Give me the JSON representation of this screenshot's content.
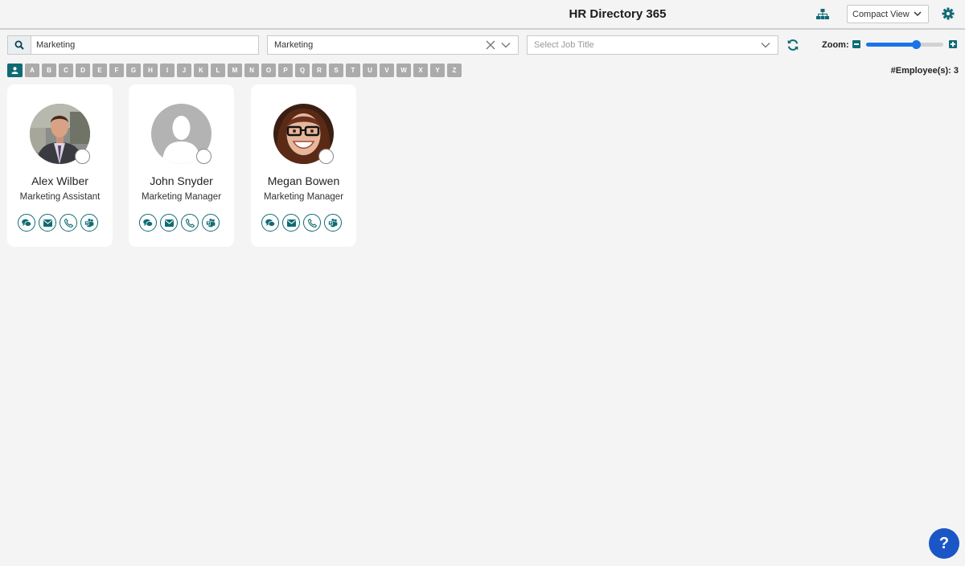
{
  "header": {
    "title": "HR Directory 365",
    "view_mode": "Compact View"
  },
  "filters": {
    "search_value": "Marketing",
    "department_value": "Marketing",
    "job_title_placeholder": "Select Job Title"
  },
  "zoom": {
    "label": "Zoom:",
    "level_fraction": 0.65
  },
  "alphabet": [
    "A",
    "B",
    "C",
    "D",
    "E",
    "F",
    "G",
    "H",
    "I",
    "J",
    "K",
    "L",
    "M",
    "N",
    "O",
    "P",
    "Q",
    "R",
    "S",
    "T",
    "U",
    "V",
    "W",
    "X",
    "Y",
    "Z"
  ],
  "employee_count_label": "#Employee(s): 3",
  "employees": [
    {
      "name": "Alex Wilber",
      "title": "Marketing Assistant",
      "photo": "man-in-suit-photo"
    },
    {
      "name": "John Snyder",
      "title": "Marketing Manager",
      "photo": "default-avatar"
    },
    {
      "name": "Megan Bowen",
      "title": "Marketing Manager",
      "photo": "woman-with-glasses-photo"
    }
  ],
  "card_actions": [
    "chat-icon",
    "email-icon",
    "phone-icon",
    "teams-icon"
  ],
  "help_label": "?",
  "colors": {
    "accent": "#0e6b74",
    "slider": "#1a73e8",
    "help": "#1a56c5",
    "letter_tile": "#ababab"
  }
}
